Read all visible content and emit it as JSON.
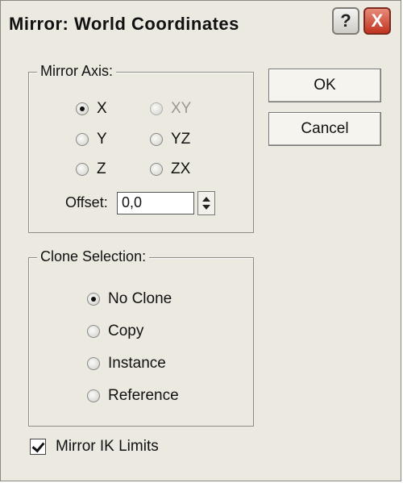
{
  "window": {
    "title": "Mirror: World Coordinates",
    "help_label": "?",
    "close_label": "X"
  },
  "mirror_axis": {
    "label": "Mirror Axis:",
    "options": [
      {
        "label": "X",
        "selected": true
      },
      {
        "label": "XY",
        "selected": false
      },
      {
        "label": "Y",
        "selected": false
      },
      {
        "label": "YZ",
        "selected": false
      },
      {
        "label": "Z",
        "selected": false
      },
      {
        "label": "ZX",
        "selected": false
      }
    ],
    "offset_label": "Offset:",
    "offset_value": "0,0"
  },
  "buttons": {
    "ok": "OK",
    "cancel": "Cancel"
  },
  "clone_selection": {
    "label": "Clone Selection:",
    "options": [
      {
        "label": "No Clone",
        "selected": true
      },
      {
        "label": "Copy",
        "selected": false
      },
      {
        "label": "Instance",
        "selected": false
      },
      {
        "label": "Reference",
        "selected": false
      }
    ]
  },
  "mirror_ik": {
    "label": "Mirror IK Limits",
    "checked": true
  },
  "colors": {
    "dialog_bg": "#ebe9e0",
    "close_red": "#c0341f"
  }
}
